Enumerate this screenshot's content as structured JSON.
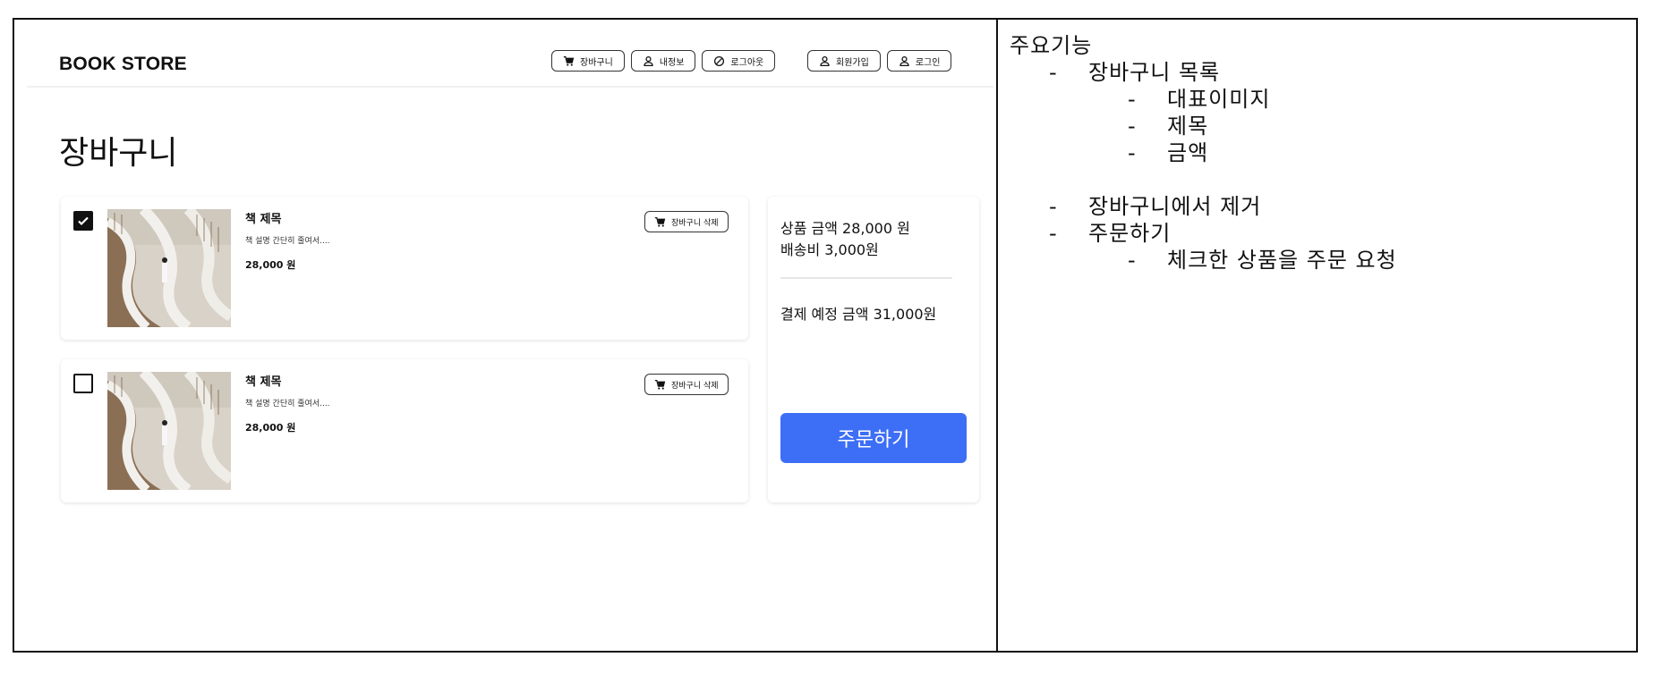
{
  "app": {
    "logo": "BOOK STORE",
    "nav": [
      {
        "label": "장바구니",
        "icon": "cart-icon"
      },
      {
        "label": "내정보",
        "icon": "user-icon"
      },
      {
        "label": "로그아웃",
        "icon": "block-icon"
      },
      {
        "label": "회원가입",
        "icon": "user-icon"
      },
      {
        "label": "로그인",
        "icon": "user-icon"
      }
    ],
    "page_title": "장바구니",
    "items": [
      {
        "checked": true,
        "title": "책 제목",
        "description": "책 설명 간단히 줄여서....",
        "price": "28,000 원",
        "delete_label": "장바구니 삭제"
      },
      {
        "checked": false,
        "title": "책 제목",
        "description": "책 설명 간단히 줄여서....",
        "price": "28,000 원",
        "delete_label": "장바구니 삭제"
      }
    ],
    "summary": {
      "product_amount": "상품 금액 28,000 원",
      "shipping": "배송비 3,000원",
      "expected_total": "결제 예정 금액 31,000원",
      "order_button": "주문하기"
    }
  },
  "notes": {
    "heading": "주요기능",
    "items": [
      {
        "text": "장바구니 목록",
        "sub": [
          "대표이미지",
          "제목",
          "금액"
        ]
      },
      {
        "text": "장바구니에서 제거",
        "sub": []
      },
      {
        "text": "주문하기",
        "sub": [
          "체크한 상품을 주문 요청"
        ]
      }
    ],
    "bullet": "-"
  },
  "colors": {
    "accent": "#3d6ef6",
    "border": "#111111"
  }
}
